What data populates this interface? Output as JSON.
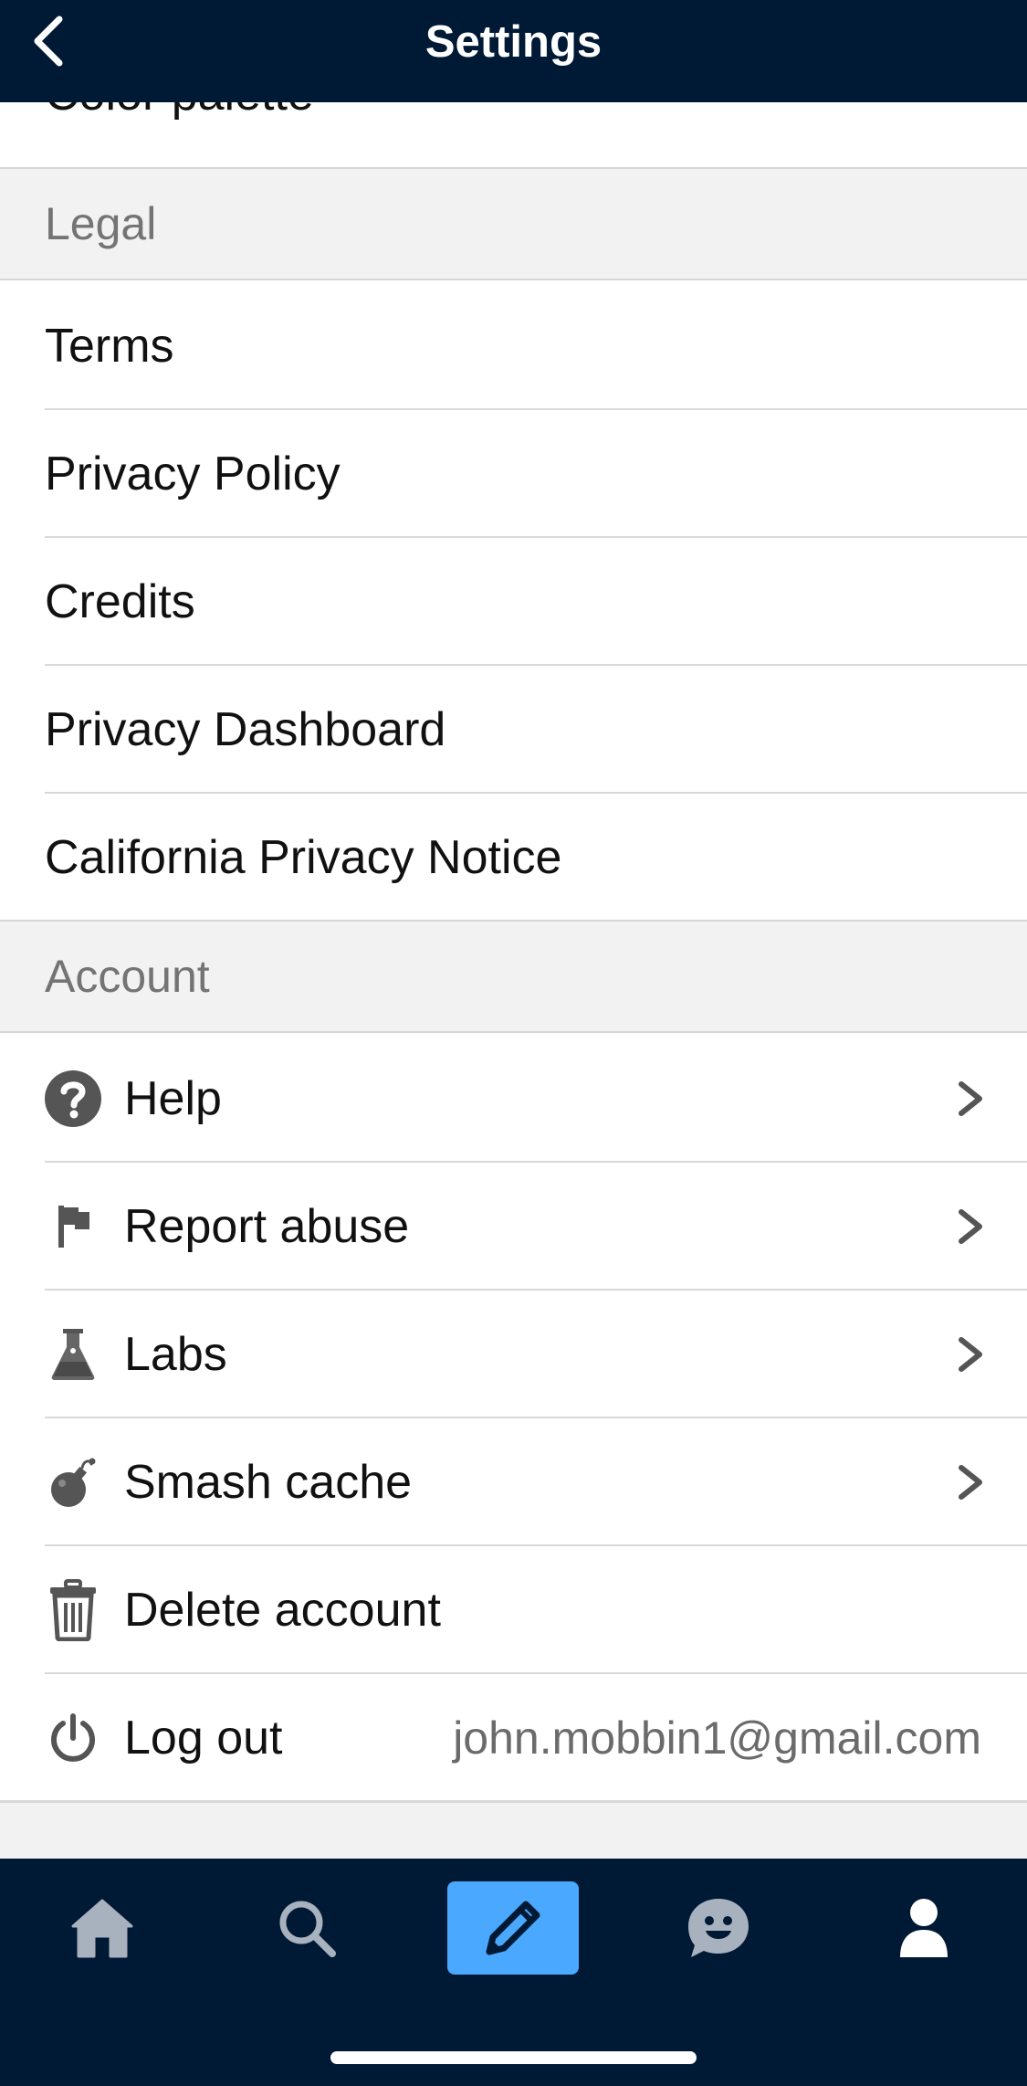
{
  "header": {
    "title": "Settings",
    "back_icon": "chevron-left-icon"
  },
  "rows_top": {
    "color_palette": "Color palette"
  },
  "sections": {
    "legal": "Legal",
    "account": "Account"
  },
  "legal_items": [
    "Terms",
    "Privacy Policy",
    "Credits",
    "Privacy Dashboard",
    "California Privacy Notice"
  ],
  "account_items": [
    {
      "label": "Help",
      "icon": "help-circle-icon",
      "chevron": true
    },
    {
      "label": "Report abuse",
      "icon": "flag-icon",
      "chevron": true
    },
    {
      "label": "Labs",
      "icon": "flask-icon",
      "chevron": true
    },
    {
      "label": "Smash cache",
      "icon": "bomb-icon",
      "chevron": true
    },
    {
      "label": "Delete account",
      "icon": "trash-icon",
      "chevron": false
    },
    {
      "label": "Log out",
      "icon": "power-icon",
      "chevron": false
    }
  ],
  "account": {
    "email": "john.mobbin1@gmail.com"
  },
  "tabbar": {
    "tabs": [
      {
        "icon": "home-icon",
        "active": false
      },
      {
        "icon": "search-icon",
        "active": false
      },
      {
        "icon": "pencil-icon",
        "active": true
      },
      {
        "icon": "chat-smile-icon",
        "active": false
      },
      {
        "icon": "profile-icon",
        "active": false
      }
    ]
  },
  "colors": {
    "navy": "#001935",
    "accent": "#4aa8ff",
    "section_bg": "#f2f2f2",
    "divider": "#d9d9d9",
    "tab_icon_inactive": "#a8b1be"
  }
}
